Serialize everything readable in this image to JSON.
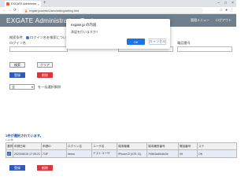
{
  "browser": {
    "tab_title": "EXGATE Administration Tool",
    "tab_close": "×",
    "new_tab": "+",
    "win_min": "–",
    "win_max": "□",
    "win_close": "×",
    "url": "exgate.jp/admin/Users/setting/setting.html",
    "back": "←",
    "forward": "→",
    "reload": "⟳",
    "lock": "🔒",
    "menu": "⋮"
  },
  "header": {
    "title": "EXGATE Administration Tool",
    "links": [
      "管理メニュー",
      "ログアウト"
    ]
  },
  "search": {
    "condition_label": "検索条件",
    "radio_label": "ログイン名を検索について",
    "login_label": "ログイン名",
    "field2_label": "ユーザ名",
    "phone_label": "電話番号",
    "search_button": "検索",
    "clear_button": "クリア",
    "register_button": "登録",
    "delete_button": "削除"
  },
  "list": {
    "page_size": "全",
    "page_size_suffix": "を一括選択解除",
    "selected_count_text": "1件が選択されています。",
    "sub_label": "1-1/1件",
    "columns": [
      "選択",
      "申請日時",
      "申請ID",
      "ログイン名",
      "ユーザ名",
      "端末機種",
      "端末識別番号",
      "電話番号",
      "ステ"
    ],
    "rows": [
      [
        "2023/08/15 17:05:21",
        "7/3F",
        "demo",
        "テストユーザ",
        "iPhone12 (iOS 11)",
        "7f4fb3ad9c8c3e",
        "09",
        "OK"
      ]
    ],
    "register_button": "登録",
    "delete_button": "削除"
  },
  "dialog": {
    "title": "exgate.jp の内容",
    "message": "承認を行いますか?",
    "ok_label": "OK",
    "cancel_label": "キャンセル"
  }
}
